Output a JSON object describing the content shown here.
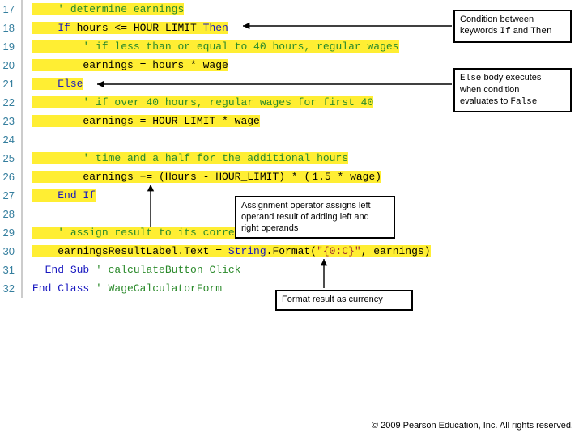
{
  "code": {
    "lines": [
      {
        "n": "17",
        "html": "<span class='hl'>    <span class='cm'>' determine earnings</span></span>"
      },
      {
        "n": "18",
        "html": "<span class='hl'>    <span class='kw'>If</span> hours &lt;= HOUR_LIMIT <span class='kw'>Then</span></span>"
      },
      {
        "n": "19",
        "html": "<span class='hl'>        <span class='cm'>' if less than or equal to 40 hours, regular wages</span></span>"
      },
      {
        "n": "20",
        "html": "<span class='hl'>        earnings = hours * wage</span>"
      },
      {
        "n": "21",
        "html": "<span class='hl'>    <span class='kw'>Else</span></span>"
      },
      {
        "n": "22",
        "html": "<span class='hl'>        <span class='cm'>' if over 40 hours, regular wages for first 40</span></span>"
      },
      {
        "n": "23",
        "html": "<span class='hl'>        earnings = HOUR_LIMIT * wage</span>"
      },
      {
        "n": "24",
        "html": ""
      },
      {
        "n": "25",
        "html": "<span class='hl'>        <span class='cm'>' time and a half for the additional hours</span></span>"
      },
      {
        "n": "26",
        "html": "<span class='hl'>        earnings += (Hours - HOUR_LIMIT</span><span class='hlr'>) * (</span><span class='hl'>1.5 * wage)</span>"
      },
      {
        "n": "27",
        "html": "<span class='hl'>    <span class='kw'>End If</span></span>"
      },
      {
        "n": "28",
        "html": ""
      },
      {
        "n": "29",
        "html": "<span class='hl'>    <span class='cm'>' assign result to its corresponding Label</span></span>"
      },
      {
        "n": "30",
        "html": "<span class='hl'>    earningsResultLabel.Text = <span class='kw'>String</span>.Format(<span class='str'>\"{0:C}\"</span>, earnings)</span>"
      },
      {
        "n": "31",
        "html": "  <span class='kw'>End Sub</span> <span class='cm'>' calculateButton_Click</span>"
      },
      {
        "n": "32",
        "html": "<span class='kw'>End Class</span> <span class='cm'>' WageCalculatorForm</span>"
      }
    ]
  },
  "callouts": {
    "cond_a": "Condition between",
    "cond_b": "keywords ",
    "cond_if": "If",
    "cond_c": " and ",
    "cond_then": "Then",
    "else_a_pre": "",
    "else_a_kw": "Else",
    "else_a_post": " body executes",
    "else_b": "when condition",
    "else_c_pre": "evaluates to ",
    "else_c_kw": "False",
    "assign_a": "Assignment operator assigns left",
    "assign_b": "operand result of adding left and",
    "assign_c": "right operands",
    "format": "Format result as currency"
  },
  "footer": "©  2009 Pearson Education, Inc. All rights reserved."
}
